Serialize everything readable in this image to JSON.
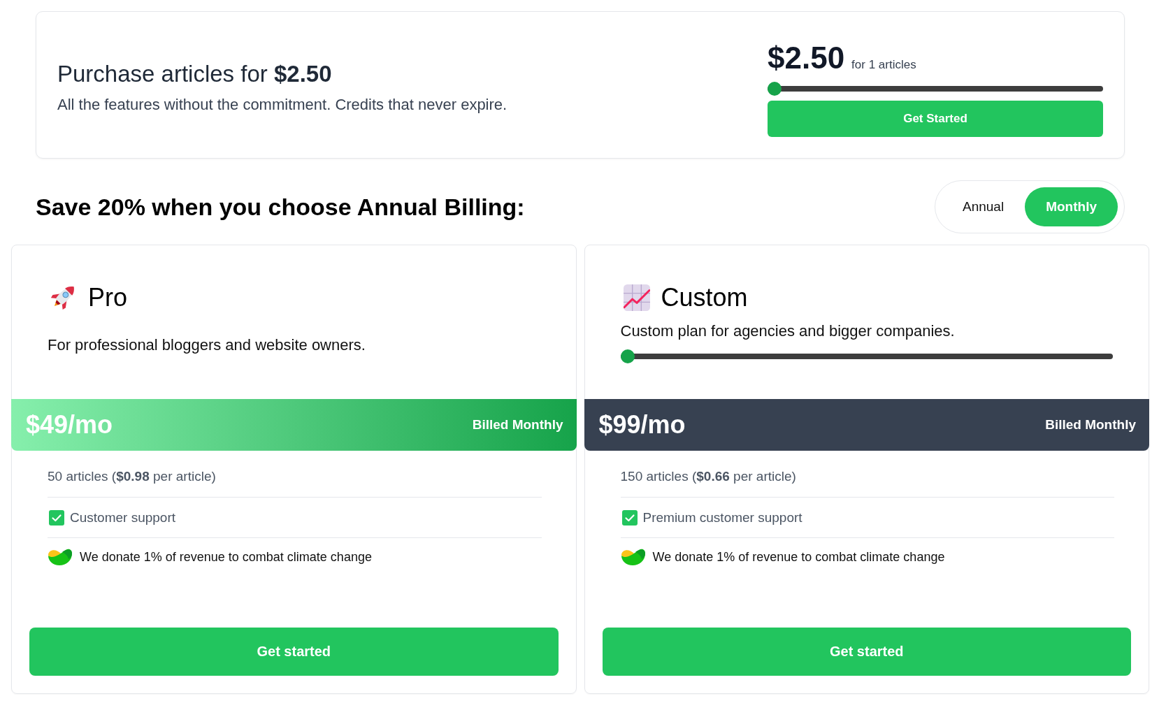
{
  "purchase": {
    "title": "Purchase articles for **$2.50**",
    "subtitle": "All the features without the commitment. Credits that never expire.",
    "amount": "$2.50",
    "amount_note": "for 1 articles",
    "slider": {
      "level": 0
    },
    "button": "Get Started"
  },
  "billing": {
    "heading": "Save 20% when you choose Annual Billing:",
    "options": [
      {
        "label": "Annual",
        "selected": false
      },
      {
        "label": "Monthly",
        "selected": true
      }
    ]
  },
  "plans": [
    {
      "kind": "featured",
      "name": "Pro",
      "description": "For professional bloggers and website owners.",
      "price": "$49/mo",
      "billing": "Billed Monthly",
      "quota": "50 articles (**$0.98** per article)",
      "features": [
        {
          "label": "Customer support",
          "checked": true
        }
      ],
      "donation": "We donate 1% of revenue to combat climate change",
      "button": "Get started"
    },
    {
      "kind": "custom",
      "name": "Custom",
      "description": "Custom plan for agencies and bigger companies.",
      "slider": {
        "level": 0
      },
      "price": "$99/mo",
      "billing": "Billed Monthly",
      "quota": "150 articles (**$0.66** per article)",
      "features": [
        {
          "label": "Premium customer support",
          "checked": true
        }
      ],
      "donation": "We donate 1% of revenue to combat climate change",
      "button": "Get started"
    }
  ]
}
